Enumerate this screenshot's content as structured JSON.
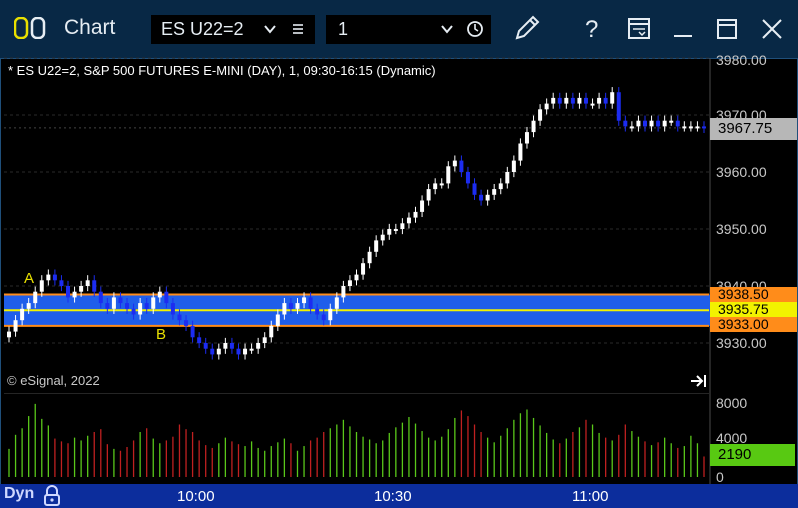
{
  "window": {
    "title": "Chart",
    "symbol": "ES U22=2",
    "interval": "1"
  },
  "chart": {
    "header": "* ES U22=2, S&P 500 FUTURES E-MINI (DAY), 1, 09:30-16:15 (Dynamic)",
    "copyright": "© eSignal, 2022",
    "current_price": "3967.75",
    "price_ticks": [
      "3980.00",
      "3970.00",
      "3960.00",
      "3950.00",
      "3930.00"
    ],
    "hidden_tick": "3940.00",
    "levels": [
      {
        "label": "3938.50",
        "color": "#ff8c1a"
      },
      {
        "label": "3935.75",
        "color": "#f2f200"
      },
      {
        "label": "3933.00",
        "color": "#ff8c1a"
      }
    ],
    "zone_color": "#1f5eea",
    "markers": {
      "a": "A",
      "b": "B"
    },
    "volume_ticks": [
      "8000",
      "4000",
      "0"
    ],
    "current_volume": "2190",
    "time_labels": [
      "10:00",
      "10:30",
      "11:00"
    ],
    "mode_label": "Dyn"
  },
  "colors": {
    "up": "#ffffff",
    "down": "#1c2cf0",
    "vol_up": "#5ac81a",
    "vol_down": "#c02020",
    "titlebar": "#082845"
  },
  "chart_data": {
    "type": "candlestick",
    "ylim": [
      3924,
      3982
    ],
    "close": [
      3932,
      3934,
      3936,
      3937,
      3939,
      3941,
      3942,
      3941,
      3940,
      3938,
      3939,
      3940,
      3941,
      3939,
      3937,
      3936,
      3938,
      3937,
      3936,
      3935,
      3937,
      3936,
      3938,
      3939,
      3937,
      3935,
      3934,
      3933,
      3931,
      3930,
      3929,
      3928,
      3929,
      3930,
      3929,
      3928,
      3929,
      3929,
      3930,
      3931,
      3933,
      3935,
      3937,
      3936,
      3937,
      3938,
      3936,
      3935,
      3934,
      3936,
      3938,
      3940,
      3941,
      3942,
      3944,
      3946,
      3948,
      3949,
      3950,
      3950,
      3951,
      3952,
      3953,
      3955,
      3957,
      3958,
      3958,
      3961,
      3962,
      3960,
      3958,
      3956,
      3955,
      3956,
      3957,
      3958,
      3960,
      3962,
      3965,
      3967,
      3969,
      3971,
      3972,
      3973,
      3972,
      3973,
      3972,
      3973,
      3972,
      3972,
      3973,
      3972,
      3974,
      3969,
      3968,
      3968,
      3969,
      3968,
      3969,
      3968,
      3969,
      3969,
      3968,
      3968,
      3968,
      3968,
      3967.75
    ],
    "volume": [
      3000,
      4500,
      5200,
      6500,
      7800,
      6200,
      5500,
      4100,
      3800,
      3600,
      4200,
      3900,
      4400,
      4800,
      5100,
      3500,
      3000,
      2800,
      3200,
      3900,
      4800,
      5200,
      4100,
      3600,
      3900,
      4300,
      5600,
      5100,
      4800,
      3900,
      3400,
      3100,
      3600,
      4200,
      3800,
      3500,
      3300,
      3800,
      3100,
      2800,
      3300,
      3700,
      4100,
      3600,
      2800,
      3300,
      3900,
      4200,
      4800,
      5200,
      5600,
      6100,
      5400,
      4800,
      4300,
      4000,
      3600,
      3900,
      4700,
      5300,
      5800,
      6400,
      5700,
      4900,
      4200,
      3900,
      4300,
      5100,
      6300,
      7100,
      6500,
      5600,
      4800,
      4200,
      3700,
      4400,
      5200,
      6100,
      6800,
      7200,
      6300,
      5500,
      4700,
      4000,
      3600,
      4100,
      4800,
      5300,
      6100,
      5600,
      4700,
      4200,
      3900,
      4500,
      5600,
      4900,
      4300,
      3800,
      3400,
      3700,
      4200,
      3600,
      3100,
      3300,
      4400,
      3600,
      2190
    ]
  }
}
